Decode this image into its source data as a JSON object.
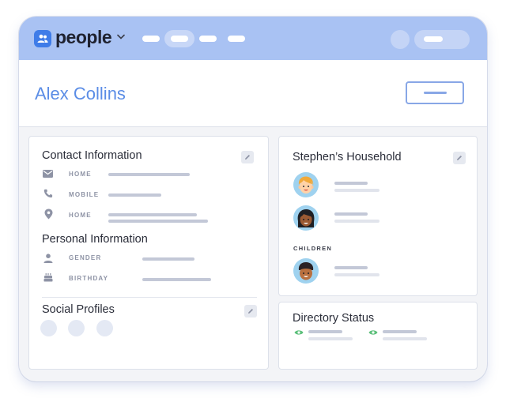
{
  "app": {
    "brand": "people",
    "icon": "people-logo-icon"
  },
  "header": {
    "title": "Alex Collins"
  },
  "contact": {
    "title": "Contact Information",
    "rows": [
      {
        "icon": "envelope-icon",
        "label": "HOME"
      },
      {
        "icon": "phone-icon",
        "label": "MOBILE"
      },
      {
        "icon": "map-pin-icon",
        "label": "HOME"
      }
    ]
  },
  "personal": {
    "title": "Personal Information",
    "rows": [
      {
        "icon": "person-icon",
        "label": "GENDER"
      },
      {
        "icon": "cake-icon",
        "label": "BIRTHDAY"
      }
    ]
  },
  "social": {
    "title": "Social Profiles",
    "profile_count": 3
  },
  "household": {
    "title": "Stephen’s Household",
    "children_label": "CHILDREN"
  },
  "directory": {
    "title": "Directory Status"
  },
  "colors": {
    "topbar": "#a9c2f3",
    "accent": "#5b8de6",
    "logo": "#3f7ce8",
    "eye": "#5bbf7a"
  }
}
